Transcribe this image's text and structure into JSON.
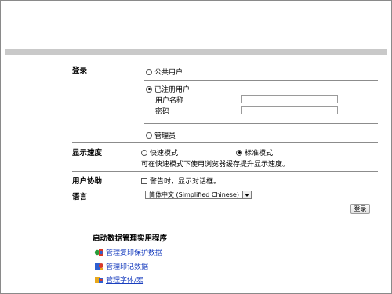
{
  "login": {
    "section_label": "登录",
    "public_user": "公共用户",
    "registered_user": "已注册用户",
    "username_label": "用户名称",
    "password_label": "密码",
    "admin": "管理员",
    "selected": "registered_user"
  },
  "display_speed": {
    "section_label": "显示速度",
    "fast_mode": "快速模式",
    "standard_mode": "标准模式",
    "selected": "standard_mode",
    "note": "可在快速模式下使用浏览器缓存提升显示速度。"
  },
  "user_assist": {
    "section_label": "用户协助",
    "warning_dialog": "警告时，显示对话框。",
    "checked": false
  },
  "language": {
    "section_label": "语言",
    "selected_value": "简体中文 (Simplified Chinese)"
  },
  "login_button": "登录",
  "utilities": {
    "title": "启动数据管理实用程序",
    "items": [
      {
        "label": "管理复印保护数据",
        "icon": "copy-protect-app-icon"
      },
      {
        "label": "管理印记数据",
        "icon": "stamp-data-app-icon"
      },
      {
        "label": "管理字体/宏",
        "icon": "font-macro-app-icon"
      }
    ]
  },
  "colors": {
    "band": "#c9c9c9",
    "link": "#1a3fbf",
    "divider": "#8c8c8c"
  }
}
